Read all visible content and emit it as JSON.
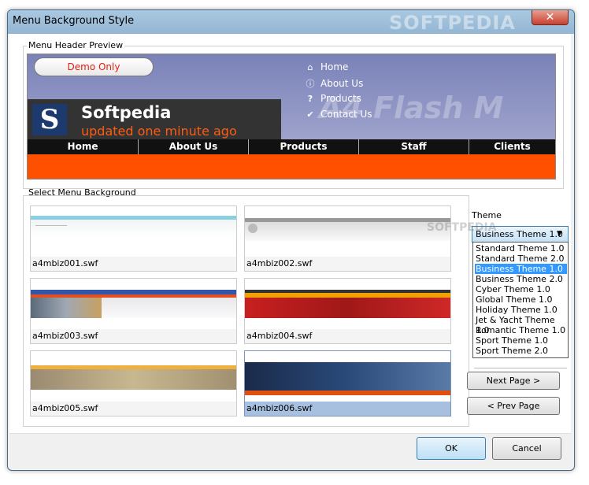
{
  "window": {
    "title": "Menu Background Style",
    "close_glyph": "✕",
    "watermark": "SOFTPEDIA"
  },
  "preview": {
    "group_label": "Menu Header Preview",
    "demo_label": "Demo Only",
    "company": "Softpedia",
    "logo_letter": "S",
    "updated": "updated one minute ago",
    "flash_text": "A4 Flash M",
    "links": [
      {
        "label": "Home",
        "icon": "house-icon"
      },
      {
        "label": "About Us",
        "icon": "info-icon"
      },
      {
        "label": "Products",
        "icon": "question-icon"
      },
      {
        "label": "Contact Us",
        "icon": "checkmark-icon"
      }
    ],
    "nav": [
      "Home",
      "About Us",
      "Products",
      "Staff",
      "Clients"
    ]
  },
  "backgrounds": {
    "group_label": "Select Menu Background",
    "items": [
      {
        "file": "a4mbiz001.swf",
        "selected": false
      },
      {
        "file": "a4mbiz002.swf",
        "selected": false
      },
      {
        "file": "a4mbiz003.swf",
        "selected": false
      },
      {
        "file": "a4mbiz004.swf",
        "selected": false
      },
      {
        "file": "a4mbiz005.swf",
        "selected": false
      },
      {
        "file": "a4mbiz006.swf",
        "selected": true
      }
    ]
  },
  "theme": {
    "label": "Theme",
    "selected": "Business Theme 1.0",
    "watermark": "SOFTPEDIA",
    "options": [
      "Standard Theme 1.0",
      "Standard Theme 2.0",
      "Business Theme 1.0",
      "Business Theme 2.0",
      "Cyber Theme 1.0",
      "Global Theme 1.0",
      "Holiday Theme 1.0",
      "Jet & Yacht Theme 1.0",
      "Romantic Theme 1.0",
      "Sport Theme 1.0",
      "Sport Theme 2.0"
    ],
    "selected_index": 2
  },
  "paging": {
    "next_label": "Next Page >",
    "prev_label": "< Prev Page"
  },
  "footer": {
    "ok_label": "OK",
    "cancel_label": "Cancel"
  },
  "colors": {
    "accent_orange": "#ff5000",
    "selection_blue": "#3399ff",
    "header_purple": "#8a8ec4"
  }
}
